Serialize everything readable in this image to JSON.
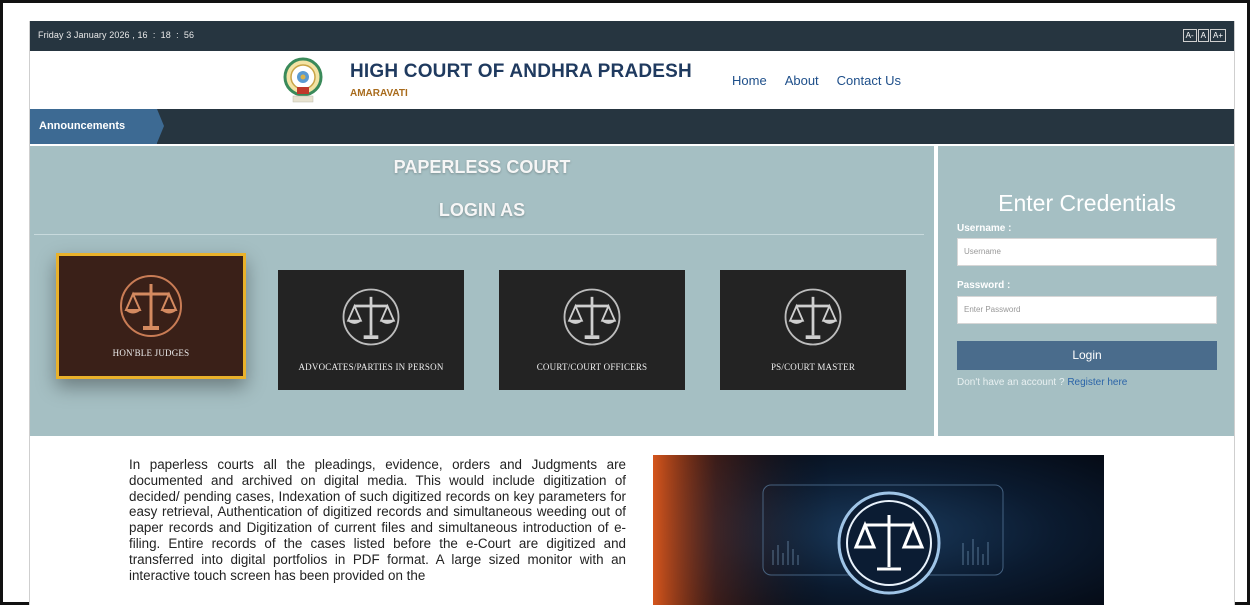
{
  "topbar": {
    "datetime": "Friday 3 January 2026 , 16  :  18  :  56",
    "font_controls": [
      "A-",
      "A",
      "A+"
    ]
  },
  "header": {
    "title": "HIGH COURT OF ANDHRA PRADESH",
    "subtitle": "AMARAVATI",
    "nav": [
      "Home",
      "About",
      "Contact Us"
    ]
  },
  "announcements": {
    "label": "Announcements"
  },
  "login_panel": {
    "heading": "PAPERLESS COURT",
    "subheading": "LOGIN AS",
    "roles": [
      {
        "label": "HON'BLE JUDGES",
        "active": true
      },
      {
        "label": "ADVOCATES/PARTIES IN PERSON",
        "active": false
      },
      {
        "label": "COURT/COURT OFFICERS",
        "active": false
      },
      {
        "label": "PS/COURT MASTER",
        "active": false
      }
    ]
  },
  "credentials": {
    "title": "Enter Credentials",
    "username_label": "Username :",
    "username_placeholder": "Username",
    "password_label": "Password :",
    "password_placeholder": "Enter Password",
    "login_button": "Login",
    "no_account_text": "Don't have an account ?",
    "register_link": "Register here"
  },
  "description": "In paperless courts all the pleadings, evidence, orders and Judgments are documented and archived on digital media. This would include digitization of decided/ pending cases, Indexation of such digitized records on key parameters for easy retrieval, Authentication of digitized records and simultaneous weeding out of paper records and Digitization of current files and simultaneous introduction of e-filing. Entire records of the cases listed before the e-Court are digitized and transferred into digital portfolios in PDF format. A large sized monitor with an interactive touch screen has been provided on the",
  "colors": {
    "topbar": "#263540",
    "panel": "#a5bfc3",
    "title": "#1f3a5f",
    "accent": "#3d6a93",
    "active_border": "#e9b12b",
    "login_button": "#4a6c8c"
  },
  "icons": [
    "emblem-logo",
    "scales-of-justice-icon"
  ]
}
